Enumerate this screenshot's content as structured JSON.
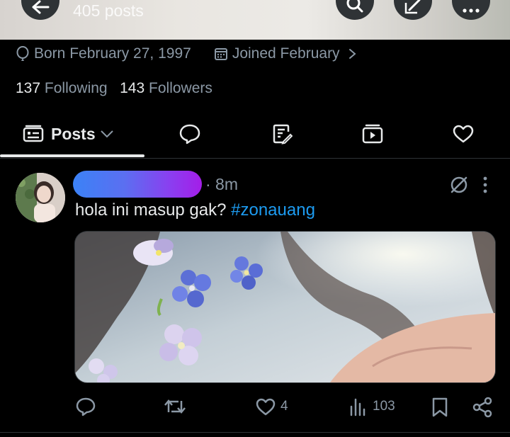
{
  "header": {
    "posts_count": "405 posts",
    "back_icon": "arrow-left-icon",
    "search_icon": "search-icon",
    "compose_icon": "compose-icon",
    "more_icon": "more-horizontal-icon"
  },
  "profile": {
    "born": "Born February 27, 1997",
    "joined": "Joined February",
    "following_count": "137",
    "following_label": "Following",
    "followers_count": "143",
    "followers_label": "Followers"
  },
  "tabs": [
    {
      "label": "Posts",
      "icon": "posts-icon",
      "active": true
    },
    {
      "icon": "replies-icon"
    },
    {
      "icon": "articles-icon"
    },
    {
      "icon": "media-icon"
    },
    {
      "icon": "likes-icon"
    }
  ],
  "post": {
    "time": "· 8m",
    "text": "hola ini masup gak?",
    "hashtag": "#zonauang",
    "actions": {
      "reply": "",
      "repost": "",
      "likes": "4",
      "views": "103"
    }
  },
  "colors": {
    "background": "#000000",
    "text": "#e7e9ea",
    "muted": "#8b98a5",
    "link": "#1d9bf0",
    "divider": "#2f3336"
  }
}
